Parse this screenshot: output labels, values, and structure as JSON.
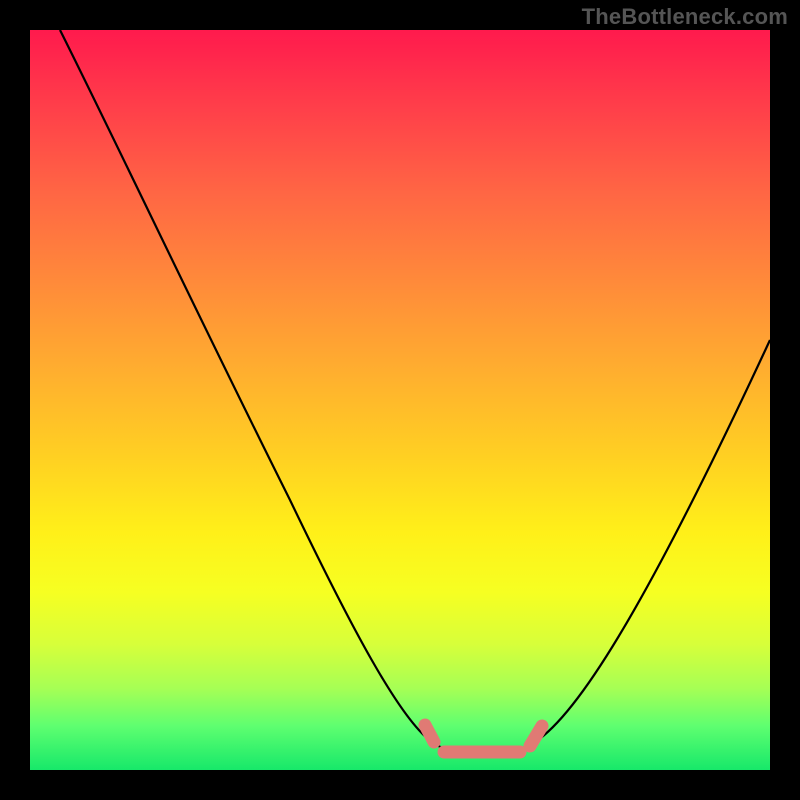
{
  "watermark": "TheBottleneck.com",
  "chart_data": {
    "type": "line",
    "title": "",
    "xlabel": "",
    "ylabel": "",
    "xlim": [
      0,
      100
    ],
    "ylim": [
      0,
      100
    ],
    "grid": false,
    "legend": false,
    "background_gradient": {
      "top": "#ff1a4d",
      "mid": "#fff019",
      "bottom": "#17e86a"
    },
    "series": [
      {
        "name": "bottleneck-curve",
        "color": "#000000",
        "x": [
          4,
          10,
          18,
          26,
          34,
          42,
          48,
          53,
          56,
          60,
          65,
          70,
          76,
          84,
          92,
          100
        ],
        "y": [
          100,
          87,
          73,
          59,
          45,
          30,
          17,
          8,
          4,
          3,
          3,
          5,
          12,
          26,
          42,
          58
        ]
      },
      {
        "name": "optimal-zone-marker",
        "color": "#e07a74",
        "x": [
          53,
          56,
          58,
          60,
          62,
          64,
          66,
          68,
          70
        ],
        "y": [
          7,
          4,
          3,
          3,
          3,
          3,
          4,
          5,
          6
        ]
      }
    ],
    "annotations": []
  }
}
